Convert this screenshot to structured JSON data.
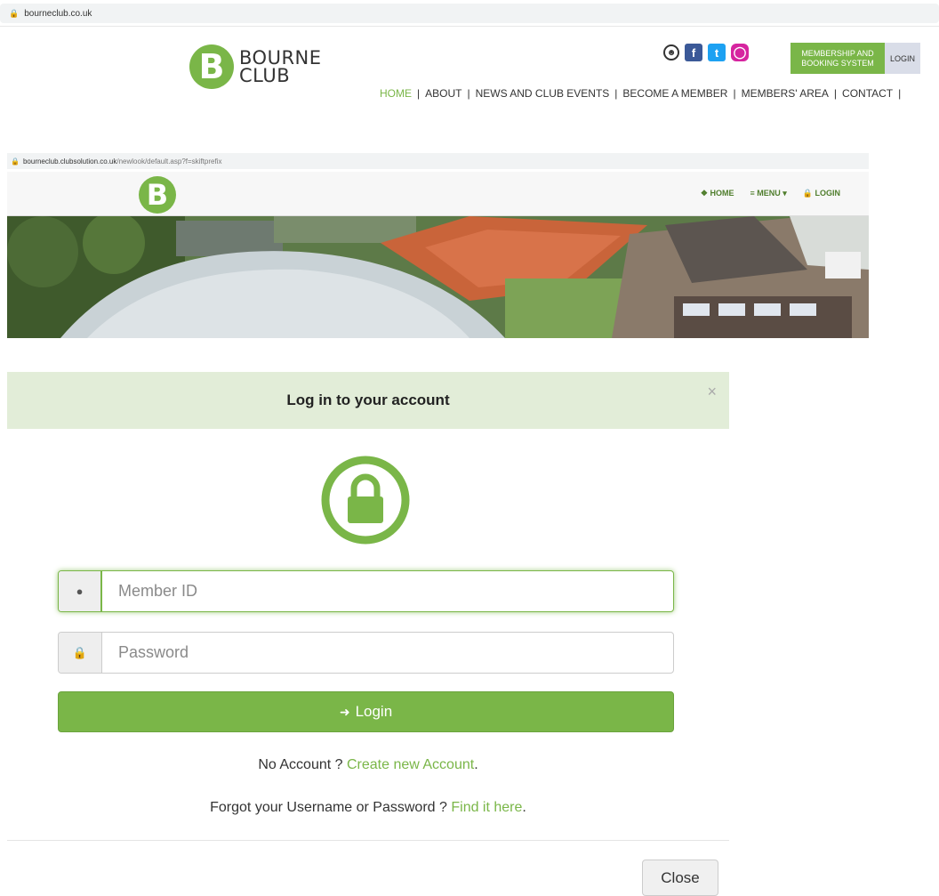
{
  "browser": {
    "url_top": "bourneclub.co.uk",
    "url_second_host": "bourneclub.clubsolution.co.uk",
    "url_second_path": "/newlook/default.asp?f=skiftprefix"
  },
  "site": {
    "logo_letter": "B",
    "logo_line1": "BOURNE",
    "logo_line2": "CLUB",
    "membership_line1": "MEMBERSHIP AND",
    "membership_line2": "BOOKING SYSTEM",
    "login_label": "LOGIN",
    "social_icons": [
      "user-icon",
      "facebook-icon",
      "twitter-icon",
      "instagram-icon"
    ],
    "nav": [
      "HOME",
      "ABOUT",
      "NEWS AND CLUB EVENTS",
      "BECOME A MEMBER",
      "MEMBERS' AREA",
      "CONTACT"
    ],
    "nav_separator": "|"
  },
  "subsite": {
    "logo_letter": "B",
    "home_label": "HOME",
    "menu_label": "MENU",
    "login_label": "LOGIN"
  },
  "modal": {
    "title": "Log in to your account",
    "close_x": "×",
    "member_id_placeholder": "Member ID",
    "password_placeholder": "Password",
    "login_button": "Login",
    "no_account_text": "No Account ?",
    "create_account_link": "Create new Account",
    "forgot_text": "Forgot your Username or Password ?",
    "find_link": "Find it here",
    "period": ".",
    "close_button": "Close"
  },
  "colors": {
    "accent": "#7ab648",
    "header_bg": "#e2edd8"
  }
}
